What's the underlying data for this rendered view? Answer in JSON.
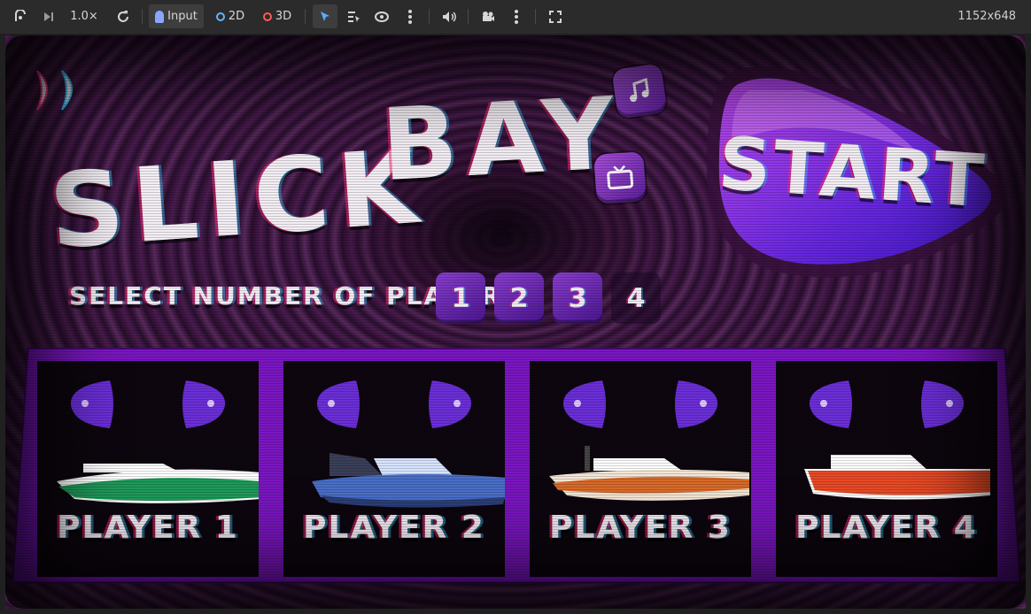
{
  "toolbar": {
    "speed": "1.0×",
    "input_label": "Input",
    "mode_2d": "2D",
    "mode_3d": "3D",
    "resolution": "1152x648"
  },
  "game": {
    "title_word1": "SLICK",
    "title_word2": "BAY",
    "start_label": "START",
    "select_label": "SELECT NUMBER OF PLAYERS:",
    "player_counts": [
      "1",
      "2",
      "3",
      "4"
    ],
    "players": [
      {
        "label": "PLAYER 1",
        "hull": "#ffffff",
        "stripe": "#1f9a5a"
      },
      {
        "label": "PLAYER 2",
        "hull": "#4a6fc8",
        "stripe": "#2c3f78"
      },
      {
        "label": "PLAYER 3",
        "hull": "#f3e6d6",
        "stripe": "#d86a2a"
      },
      {
        "label": "PLAYER 4",
        "hull": "#ffffff",
        "stripe": "#e84a26"
      }
    ]
  },
  "colors": {
    "accent": "#7b16c2",
    "button": "#8a3fd0",
    "toolbar_bg": "#2b2b2b"
  }
}
